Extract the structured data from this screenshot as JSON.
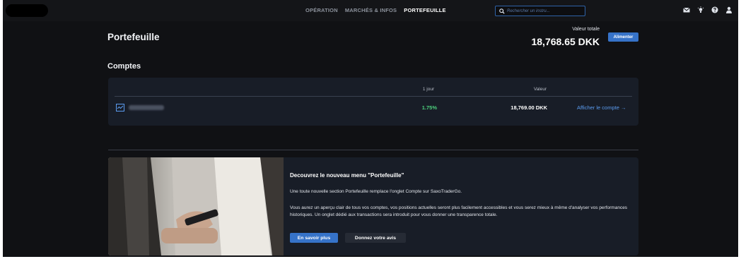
{
  "nav": {
    "tabs": [
      {
        "label": "OPÉRATION"
      },
      {
        "label": "MARCHÉS & INFOS"
      },
      {
        "label": "PORTEFEUILLE"
      }
    ],
    "active_tab": "PORTEFEUILLE"
  },
  "search": {
    "placeholder": "Rechercher un instru..."
  },
  "topbar_icons": [
    "mail-icon",
    "lightbulb-icon",
    "help-icon",
    "user-icon"
  ],
  "header": {
    "title": "Portefeuille",
    "total_label": "Valeur totale",
    "total_value": "18,768.65 DKK",
    "fund_button": "Alimenter"
  },
  "accounts": {
    "section_title": "Comptes",
    "columns": {
      "day": "1 jour",
      "value": "Valeur"
    },
    "rows": [
      {
        "day_change": "1.75%",
        "value": "18,769.00 DKK",
        "link": "Afficher le compte →"
      }
    ]
  },
  "promo": {
    "title": "Decouvrez le nouveau menu \"Portefeuille\"",
    "p1": "Une toute nouvelle section Portefeuille remplace l'onglet Compte sur SaxoTraderGo.",
    "p2": "Vous aurez un aperçu clair de tous vos comptes, vos positions actuelles seront plus facilement accessibles et vous serez mieux à même d'analyser vos performances historiques. Un onglet dédié aux transactions sera introduit pour vous donner une transparence totale.",
    "learn_more": "En savoir plus",
    "feedback": "Donnez votre avis"
  },
  "colors": {
    "accent": "#3673c9",
    "positive": "#4cd07d",
    "link": "#5b9cf0",
    "background": "#101114",
    "card": "#181d27"
  }
}
